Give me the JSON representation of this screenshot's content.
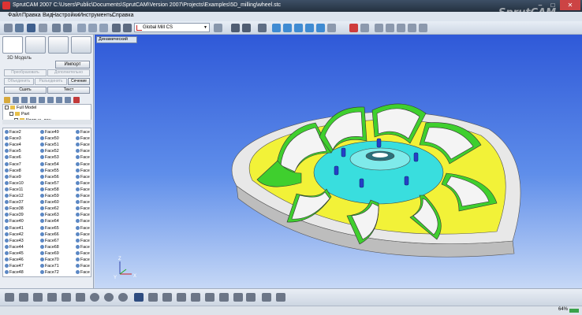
{
  "window": {
    "title": "SprutCAM 2007   C:\\Users\\Public\\Documents\\SprutCAM\\Version 2007\\Projects\\Examples\\5D_milling\\wheel.stc",
    "brand": "SprutCAM",
    "minimize": "–",
    "maximize": "□",
    "close": "✕"
  },
  "menu": [
    "Файл",
    "Правка",
    "Вид",
    "Настройки",
    "Инструменты",
    "Справка"
  ],
  "toolbar": {
    "coordinate_system": "Global Mill CS"
  },
  "left_panel": {
    "section_label": "3D Модель",
    "import_button": "Импорт",
    "buttons_row1": [
      "Преобразовать",
      "Дополнительно"
    ],
    "buttons_row2": [
      "Объединить",
      "Разъединить",
      "Сечение"
    ],
    "buttons_row3": [
      "Сшить",
      "Текст"
    ],
    "tree": [
      {
        "label": "Full Model"
      },
      {
        "label": "Part"
      },
      {
        "label": "Кривые, лин..."
      }
    ],
    "faces_col1": [
      "Face2",
      "Face3",
      "Face4",
      "Face5",
      "Face6",
      "Face7",
      "Face8",
      "Face9",
      "Face10",
      "Face11",
      "Face12",
      "Face37",
      "Face38",
      "Face39",
      "Face40",
      "Face41",
      "Face42",
      "Face43",
      "Face44",
      "Face45",
      "Face46",
      "Face47",
      "Face48"
    ],
    "faces_col2": [
      "Face49",
      "Face50",
      "Face51",
      "Face52",
      "Face53",
      "Face54",
      "Face55",
      "Face56",
      "Face57",
      "Face58",
      "Face59",
      "Face60",
      "Face62",
      "Face63",
      "Face64",
      "Face65",
      "Face66",
      "Face67",
      "Face68",
      "Face69",
      "Face70",
      "Face71",
      "Face72"
    ],
    "faces_col3": [
      "Face",
      "Face",
      "Face",
      "Face",
      "Face",
      "Face",
      "Face",
      "Face",
      "Face",
      "Face",
      "Face",
      "Face",
      "Face",
      "Face",
      "Face",
      "Face",
      "Face",
      "Face",
      "Face",
      "Face",
      "Face",
      "Face",
      "Face"
    ]
  },
  "viewport": {
    "view_mode": "Динамический",
    "axis_labels": {
      "x": "X",
      "y": "Y",
      "z": "Z"
    }
  },
  "status": {
    "zoom": "64%"
  },
  "colors": {
    "face_yellow": "#f2f238",
    "blade_green": "#3fcf2e",
    "hub_cyan": "#38e0e0",
    "blade_white": "#f2f2f2",
    "disk_gray": "#d8d8d8"
  }
}
